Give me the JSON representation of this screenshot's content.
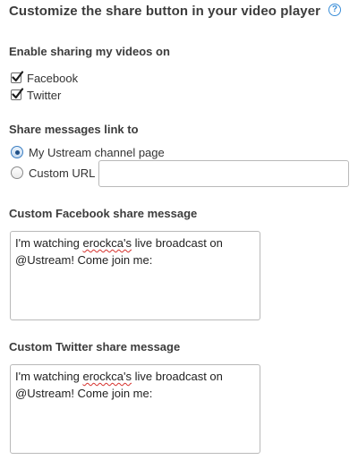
{
  "title": "Customize the share button in your video player",
  "help_icon": {
    "name": "help-icon",
    "glyph": "?"
  },
  "sharing": {
    "label": "Enable sharing my videos on",
    "options": [
      {
        "label": "Facebook",
        "checked": true
      },
      {
        "label": "Twitter",
        "checked": true
      }
    ]
  },
  "link": {
    "label": "Share messages link to",
    "options": [
      {
        "label": "My Ustream channel page",
        "selected": true
      },
      {
        "label": "Custom URL",
        "selected": false
      }
    ],
    "custom_url_value": ""
  },
  "facebook_message": {
    "label": "Custom Facebook share message",
    "text_before": "I'm watching ",
    "misspelled_word": "erockca's",
    "text_after": " live broadcast on @Ustream! Come join me:"
  },
  "twitter_message": {
    "label": "Custom Twitter share message",
    "text_before": "I'm watching ",
    "misspelled_word": "erockca's",
    "text_after": " live broadcast on @Ustream! Come join me:"
  },
  "colors": {
    "accent": "#3a8ed8",
    "text": "#333333",
    "border": "#b9b9b9",
    "spellcheck": "#d6322e"
  }
}
